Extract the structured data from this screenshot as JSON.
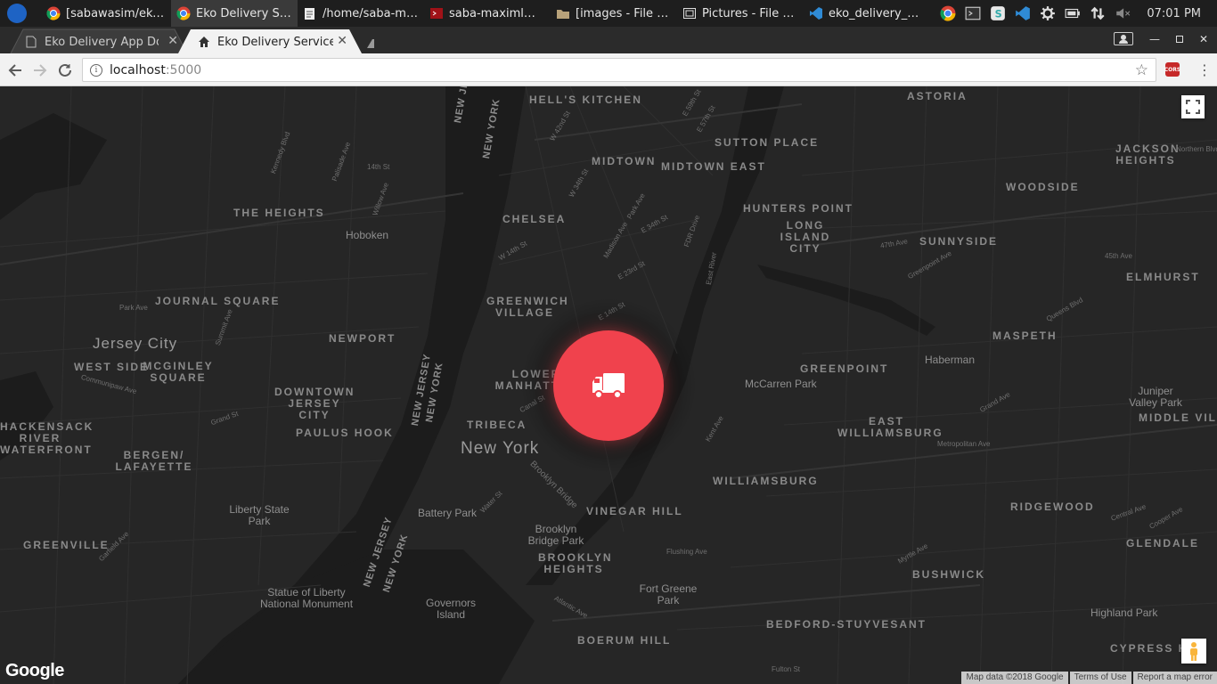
{
  "taskbar": {
    "apps": [
      {
        "label": "[sabawasim/eko_...",
        "icon": "chrome-icon",
        "active": false
      },
      {
        "label": "Eko Delivery Serv...",
        "icon": "chrome-icon",
        "active": true
      },
      {
        "label": "/home/saba-max...",
        "icon": "text-editor-icon",
        "active": false
      },
      {
        "label": "saba-maximl@sa...",
        "icon": "terminal-icon",
        "active": false
      },
      {
        "label": "[images - File Ma...",
        "icon": "folder-icon",
        "active": false
      },
      {
        "label": "Pictures - File Ma...",
        "icon": "image-viewer-icon",
        "active": false
      },
      {
        "label": "eko_delivery_app...",
        "icon": "vscode-icon",
        "active": false
      }
    ],
    "clock": "07:01 PM"
  },
  "browser": {
    "tabs": [
      {
        "title": "Eko Delivery App Doc",
        "icon": "document-icon",
        "active": false
      },
      {
        "title": "Eko Delivery Service",
        "icon": "home-icon",
        "active": true
      }
    ],
    "url_host": "localhost",
    "url_port": ":5000",
    "cors_label": "CORS"
  },
  "map": {
    "neighborhoods": [
      "HELL'S KITCHEN",
      "ASTORIA",
      "SUTTON PLACE",
      "MIDTOWN",
      "MIDTOWN EAST",
      "JACKSON HEIGHTS",
      "THE HEIGHTS",
      "CHELSEA",
      "HUNTERS POINT",
      "WOODSIDE",
      "LONG ISLAND CITY",
      "SUNNYSIDE",
      "JOURNAL SQUARE",
      "GREENWICH VILLAGE",
      "ELMHURST",
      "NEWPORT",
      "MASPETH",
      "WEST SIDE",
      "MCGINLEY SQUARE",
      "LOWER MANHATTAN",
      "GREENPOINT",
      "DOWNTOWN JERSEY CITY",
      "PAULUS HOOK",
      "TRIBECA",
      "EAST WILLIAMSBURG",
      "MIDDLE VILLAGE",
      "HACKENSACK RIVER WATERFRONT",
      "BERGEN/ LAFAYETTE",
      "WILLIAMSBURG",
      "VINEGAR HILL",
      "RIDGEWOOD",
      "GREENVILLE",
      "GLENDALE",
      "BROOKLYN HEIGHTS",
      "BUSHWICK",
      "BEDFORD-STUYVESANT",
      "BOERUM HILL",
      "CYPRESS H"
    ],
    "cities": [
      "Jersey City",
      "New York",
      "Hoboken"
    ],
    "pois": [
      "Haberman",
      "McCarren Park",
      "Liberty State Park",
      "Battery Park",
      "Brooklyn Bridge Park",
      "Juniper Valley Park",
      "Statue of Liberty National Monument",
      "Governors Island",
      "Fort Greene Park",
      "Highland Park"
    ],
    "states": [
      "NEW JERSEY",
      "NEW YORK"
    ],
    "roads": [
      "W 42nd St",
      "E 59th St",
      "E 57th St",
      "W 34th St",
      "Madison Ave",
      "Park Ave",
      "FDR Drive",
      "East River",
      "E 34th St",
      "W 14th St",
      "E 14th St",
      "E 23rd St",
      "Canal St",
      "Grand St",
      "Kent Ave",
      "Brooklyn Bridge",
      "Water St",
      "Flushing Ave",
      "Atlantic Ave",
      "Fulton St",
      "Metropolitan Ave",
      "Grand Ave",
      "Myrtle Ave",
      "Central Ave",
      "Cooper Ave",
      "Northern Blvd",
      "45th Ave",
      "47th Ave",
      "Greenpoint Ave",
      "Queens Blvd",
      "Summit Ave",
      "Palisade Ave",
      "Kennedy Blvd",
      "Communipaw Ave",
      "Garfield Ave",
      "Willow Ave",
      "14th St",
      "Park Ave"
    ],
    "attribution": {
      "data": "Map data ©2018 Google",
      "terms": "Terms of Use",
      "report": "Report a map error"
    },
    "logo": "Google",
    "marker_icon": "truck-icon",
    "marker_color": "#f0424d"
  }
}
